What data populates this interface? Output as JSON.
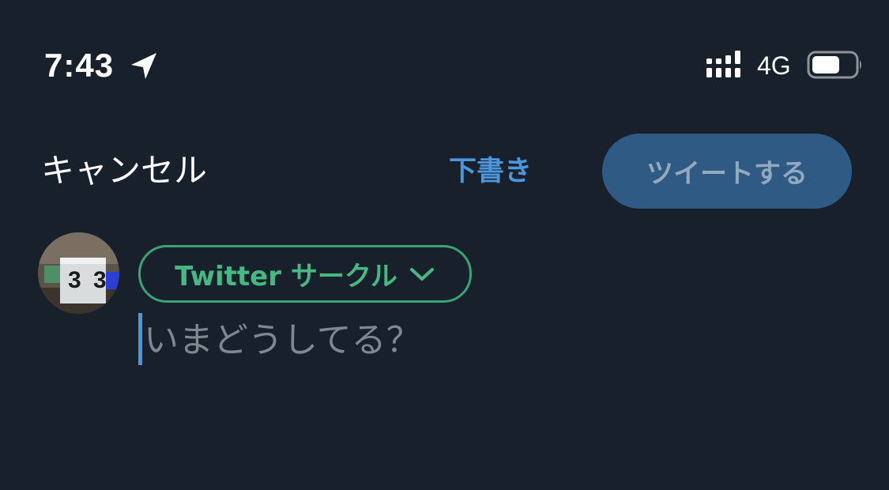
{
  "status_bar": {
    "time": "7:43",
    "network": "4G",
    "icons": [
      "location-arrow-icon",
      "signal-icon",
      "battery-icon"
    ]
  },
  "header": {
    "cancel_label": "キャンセル",
    "drafts_label": "下書き",
    "tweet_label": "ツイートする"
  },
  "audience": {
    "label": "Twitter サークル",
    "icon": "chevron-down-icon"
  },
  "compose": {
    "placeholder": "いまどうしてる？",
    "value": ""
  },
  "colors": {
    "background": "#18202c",
    "accent_blue": "#4a97de",
    "tweet_button_disabled": "#2f5a83",
    "circle_green": "#46b983"
  }
}
